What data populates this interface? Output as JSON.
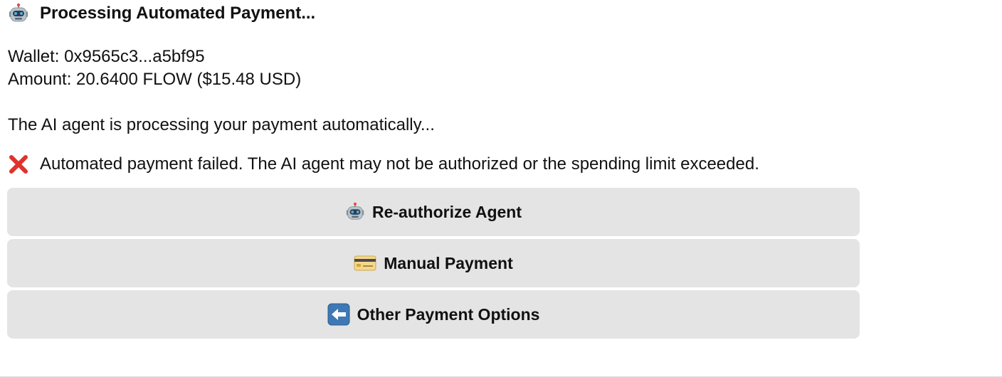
{
  "message": {
    "title_icon": "robot-icon",
    "title": "Processing Automated Payment...",
    "wallet_line": "Wallet: 0x9565c3...a5bf95",
    "amount_line": "Amount: 20.6400 FLOW ($15.48 USD)",
    "status_line": "The AI agent is processing your payment automatically...",
    "error_icon": "cross-mark-icon",
    "error_line": "Automated payment failed. The AI agent may not be authorized or the spending limit exceeded."
  },
  "buttons": [
    {
      "icon": "robot-icon",
      "label": "Re-authorize Agent"
    },
    {
      "icon": "credit-card-icon",
      "label": "Manual Payment"
    },
    {
      "icon": "left-arrow-icon",
      "label": "Other Payment Options"
    }
  ],
  "colors": {
    "button_bg": "#e4e4e4",
    "error_red": "#e0322d",
    "arrow_blue": "#3e79b5"
  }
}
